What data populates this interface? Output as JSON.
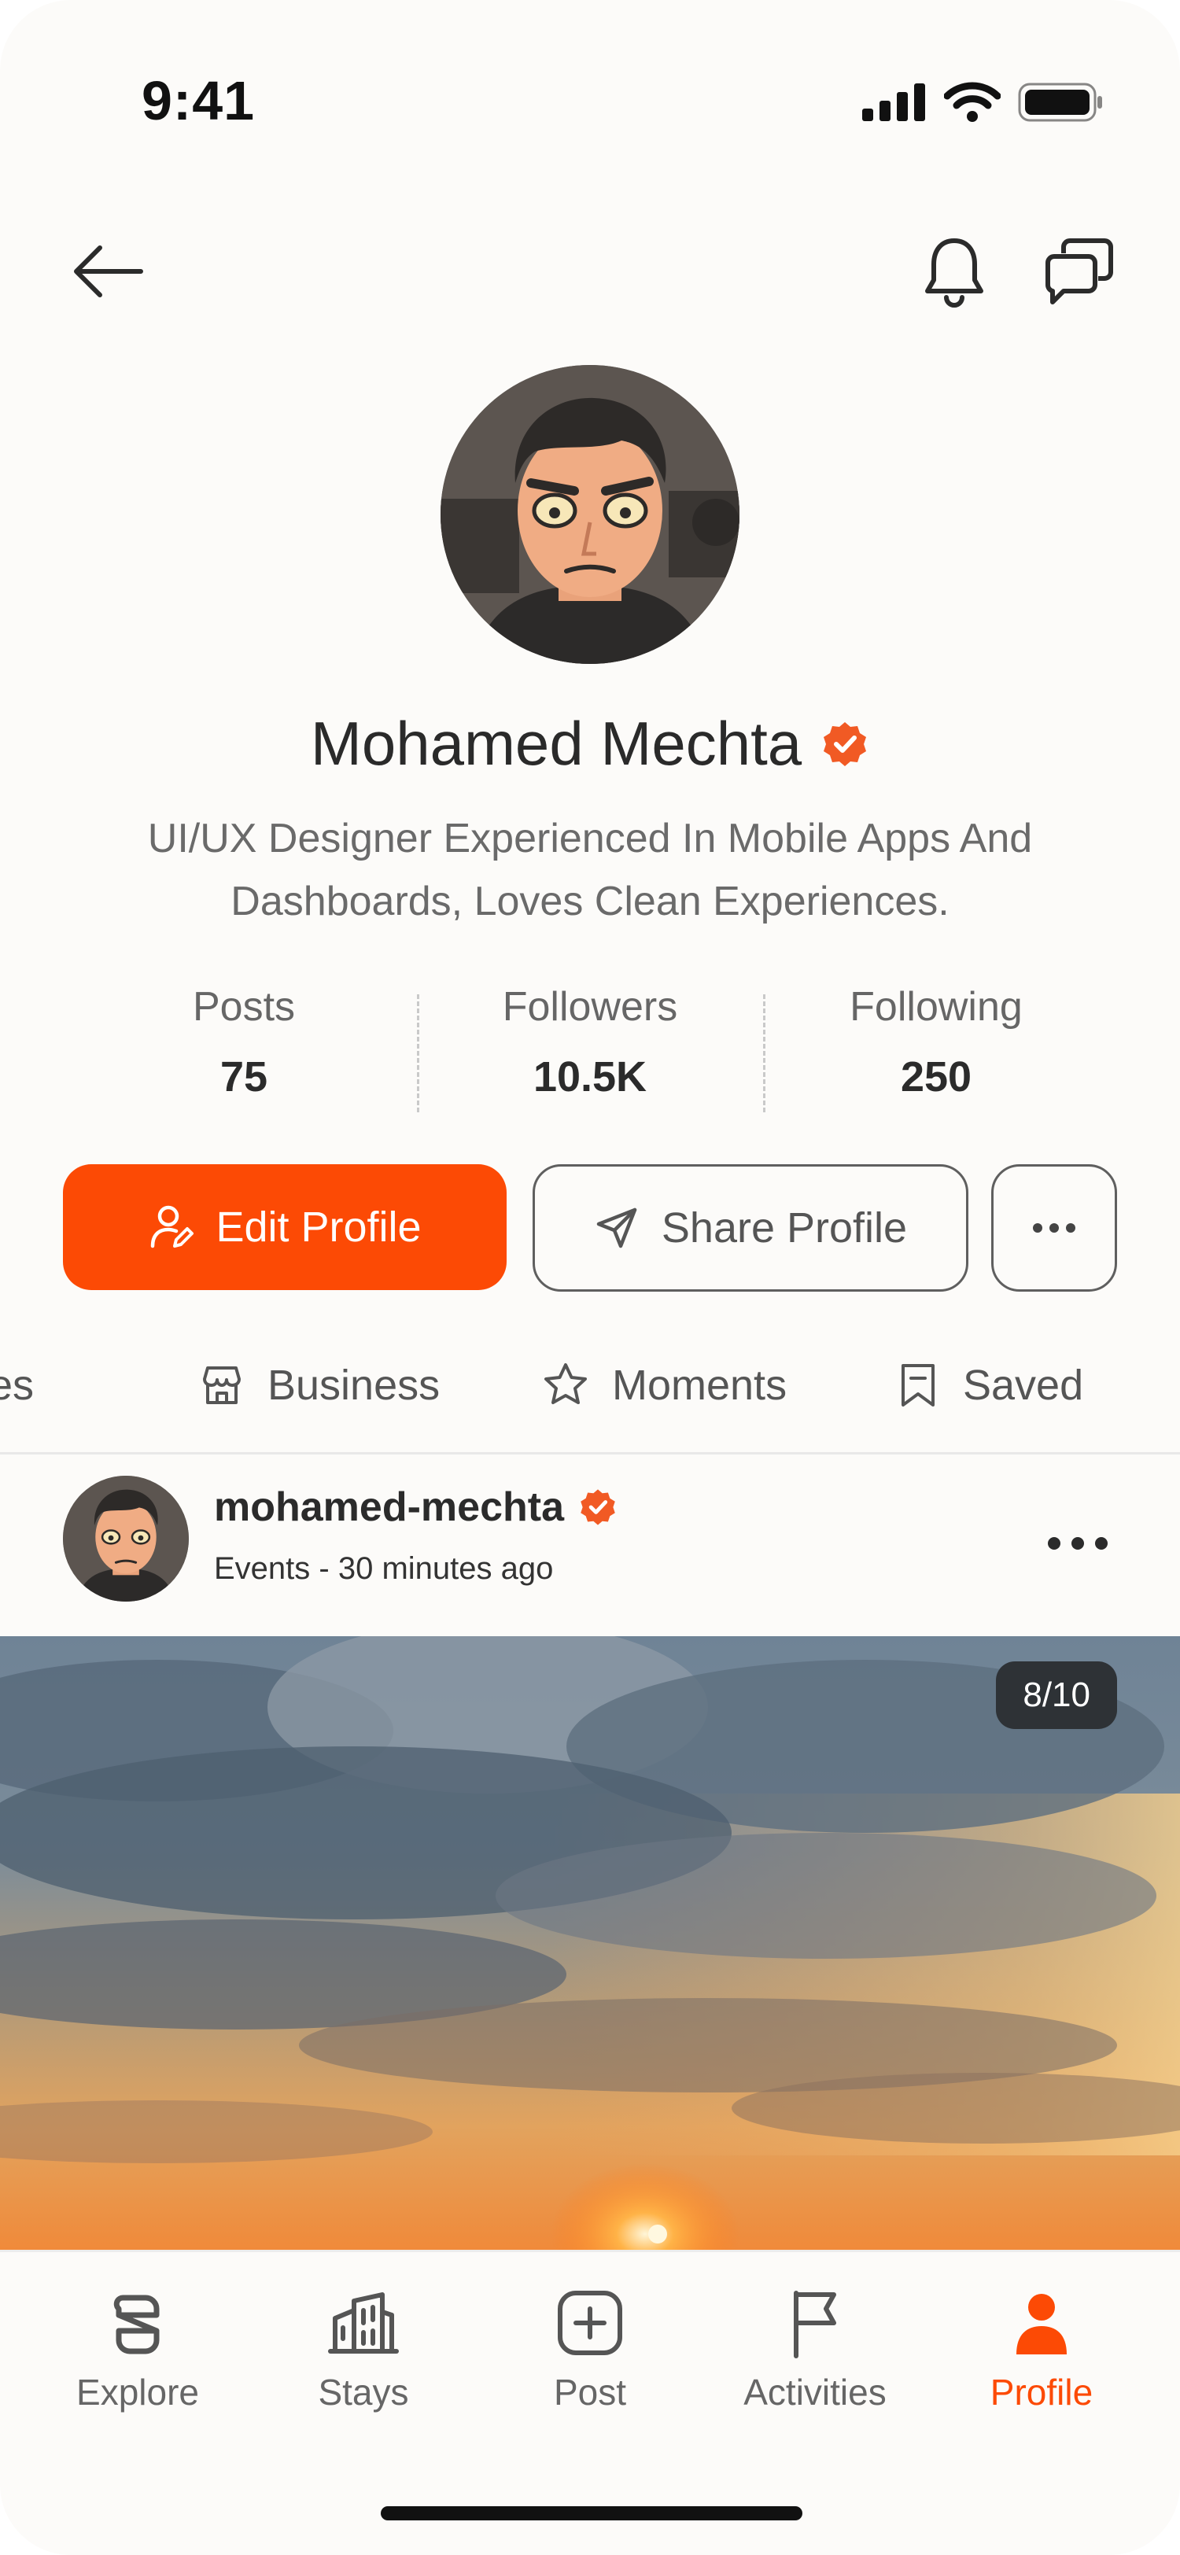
{
  "status_bar": {
    "time": "9:41"
  },
  "profile": {
    "name": "Mohamed Mechta",
    "bio": "UI/UX Designer Experienced In Mobile Apps And Dashboards, Loves Clean Experiences.",
    "stats": [
      {
        "label": "Posts",
        "value": "75"
      },
      {
        "label": "Followers",
        "value": "10.5K"
      },
      {
        "label": "Following",
        "value": "250"
      }
    ]
  },
  "actions": {
    "edit_label": "Edit Profile",
    "share_label": "Share Profile"
  },
  "tabs": [
    {
      "label": "Activities"
    },
    {
      "label": "Business"
    },
    {
      "label": "Moments"
    },
    {
      "label": "Saved"
    }
  ],
  "post": {
    "username": "mohamed-mechta",
    "meta": "Events - 30 minutes ago",
    "image_counter": "8/10"
  },
  "tabbar": [
    {
      "label": "Explore",
      "icon": "explore-icon",
      "active": false
    },
    {
      "label": "Stays",
      "icon": "buildings-icon",
      "active": false
    },
    {
      "label": "Post",
      "icon": "plus-square-icon",
      "active": false
    },
    {
      "label": "Activities",
      "icon": "flag-icon",
      "active": false
    },
    {
      "label": "Profile",
      "icon": "person-icon",
      "active": true
    }
  ],
  "colors": {
    "accent": "#fc4a05",
    "verified": "#f15a24",
    "text": "#2b2b2b"
  }
}
